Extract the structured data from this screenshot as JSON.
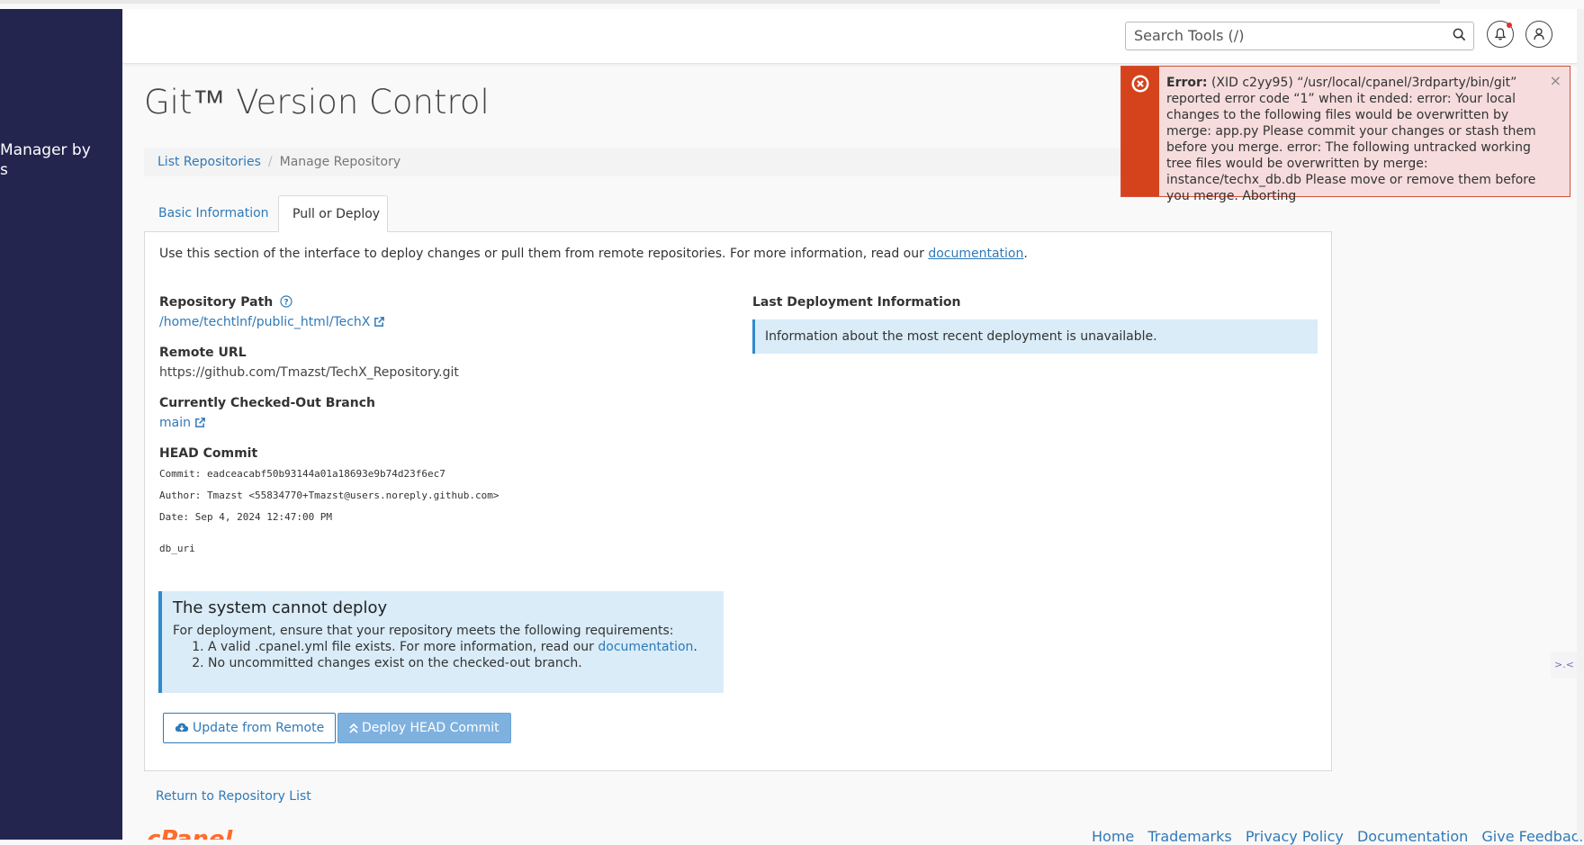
{
  "sidebar": {
    "partial_text": "Manager by\ns"
  },
  "header": {
    "search_placeholder": "Search Tools (/)",
    "icons": [
      "search-icon",
      "bell-icon",
      "user-icon"
    ]
  },
  "page": {
    "title": "Git™ Version Control",
    "breadcrumb": {
      "link": "List Repositories",
      "separator": "/",
      "current": "Manage Repository"
    },
    "tabs": {
      "basic": "Basic Information",
      "pull": "Pull or Deploy"
    }
  },
  "panel": {
    "intro_text": "Use this section of the interface to deploy changes or pull them from remote repositories. For more information, read our ",
    "intro_link": "documentation",
    "intro_end": ".",
    "repo_path_label": "Repository Path",
    "repo_path_value": "/home/techtlnf/public_html/TechX",
    "remote_url_label": "Remote URL",
    "remote_url_value": "https://github.com/Tmazst/TechX_Repository.git",
    "branch_label": "Currently Checked-Out Branch",
    "branch_value": "main",
    "head_label": "HEAD Commit",
    "commit_line": "Commit: eadceacabf50b93144a01a18693e9b74d23f6ec7",
    "author_line": "Author: Tmazst <55834770+Tmazst@users.noreply.github.com>",
    "date_line": "Date: Sep 4, 2024 12:47:00 PM",
    "commit_message": "db_uri",
    "last_deploy_label": "Last Deployment Information",
    "last_deploy_info": "Information about the most recent deployment is unavailable.",
    "warning": {
      "title": "The system cannot deploy",
      "text": "For deployment, ensure that your repository meets the following requirements:",
      "item1_text": "A valid .cpanel.yml file exists. For more information, read our ",
      "item1_link": "documentation",
      "item1_end": ".",
      "item2_text": "No uncommitted changes exist on the checked-out branch."
    },
    "buttons": {
      "update": "Update from Remote",
      "deploy": "Deploy HEAD Commit"
    }
  },
  "return_link": "Return to Repository List",
  "footer_logo": "cPanel",
  "footer_links": [
    "Home",
    "Trademarks",
    "Privacy Policy",
    "Documentation",
    "Give Feedback"
  ],
  "error": {
    "prefix": "Error:",
    "message": " (XID c2yy95) “/usr/local/cpanel/3rdparty/bin/git” reported error code “1” when it ended: error: Your local changes to the following files would be overwritten by merge: app.py Please commit your changes or stash them before you merge. error: The following untracked working tree files would be overwritten by merge: instance/techx_db.db Please move or remove them before you merge. Aborting",
    "close": "×"
  },
  "side_widget": ">.<",
  "colors": {
    "sidebar": "#23254f",
    "link": "#2f79b8",
    "error_bar": "#d5431d",
    "error_bg": "#f6dcdc",
    "info_bg": "#d9ecf8",
    "brand_orange": "#ff6c2c"
  }
}
